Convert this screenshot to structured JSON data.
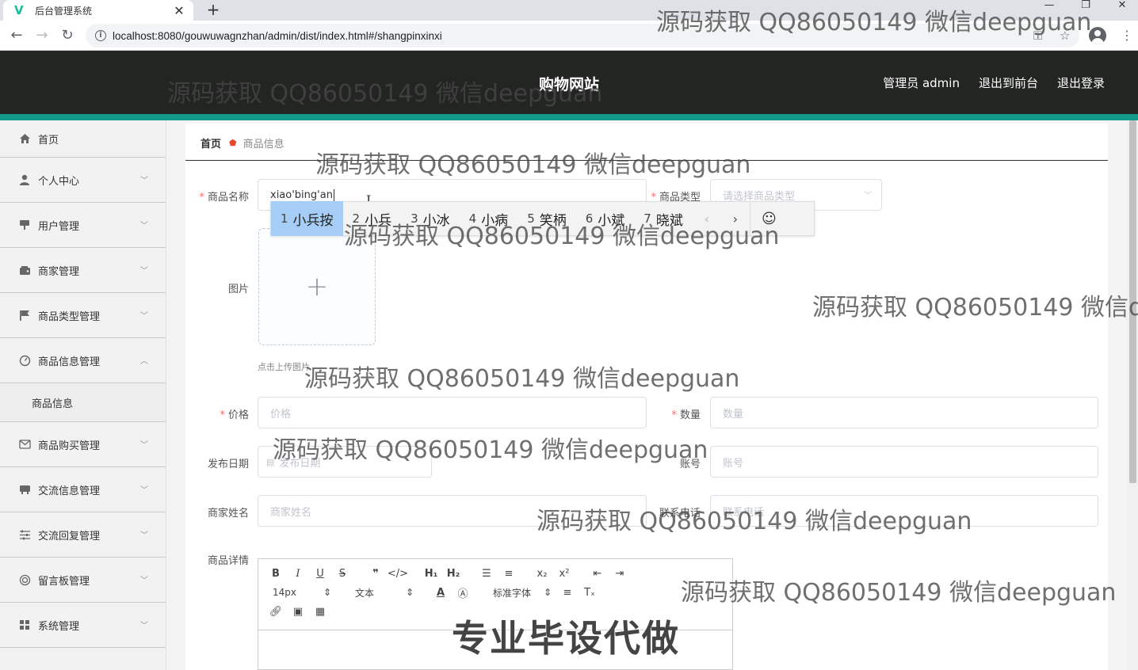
{
  "browser": {
    "tab_title": "后台管理系统",
    "url": "localhost:8080/gouwuwagnzhan/admin/dist/index.html#/shangpinxinxi"
  },
  "header": {
    "site_title": "购物网站",
    "links": [
      "管理员 admin",
      "退出到前台",
      "退出登录"
    ]
  },
  "sidebar": {
    "items": [
      {
        "label": "首页",
        "icon": "home-icon"
      },
      {
        "label": "个人中心",
        "icon": "user-icon"
      },
      {
        "label": "用户管理",
        "icon": "user-manage-icon"
      },
      {
        "label": "商家管理",
        "icon": "wallet-icon"
      },
      {
        "label": "商品类型管理",
        "icon": "flag-icon"
      },
      {
        "label": "商品信息管理",
        "icon": "gauge-icon",
        "expanded": true,
        "children": [
          "商品信息"
        ]
      },
      {
        "label": "商品购买管理",
        "icon": "mail-icon"
      },
      {
        "label": "交流信息管理",
        "icon": "chat-icon"
      },
      {
        "label": "交流回复管理",
        "icon": "sliders-icon"
      },
      {
        "label": "留言板管理",
        "icon": "target-icon"
      },
      {
        "label": "系统管理",
        "icon": "grid-icon"
      }
    ]
  },
  "breadcrumb": {
    "home": "首页",
    "current": "商品信息"
  },
  "form": {
    "name_label": "商品名称",
    "name_value": "xiao'bing'an",
    "type_label": "商品类型",
    "type_placeholder": "请选择商品类型",
    "image_label": "图片",
    "upload_hint": "点击上传图片",
    "price_label": "价格",
    "price_placeholder": "价格",
    "quantity_label": "数量",
    "quantity_placeholder": "数量",
    "date_label": "发布日期",
    "date_placeholder": "发布日期",
    "account_label": "账号",
    "account_placeholder": "账号",
    "merchant_label": "商家姓名",
    "merchant_placeholder": "商家姓名",
    "phone_label": "联系电话",
    "phone_placeholder": "联系电话",
    "detail_label": "商品详情"
  },
  "editor": {
    "font_size": "14px",
    "heading": "文本",
    "font_family": "标准字体"
  },
  "ime": {
    "candidates": [
      {
        "num": "1",
        "text": "小兵按",
        "selected": true
      },
      {
        "num": "2",
        "text": "小兵"
      },
      {
        "num": "3",
        "text": "小冰"
      },
      {
        "num": "4",
        "text": "小病"
      },
      {
        "num": "5",
        "text": "笑柄"
      },
      {
        "num": "6",
        "text": "小斌"
      },
      {
        "num": "7",
        "text": "晓斌"
      }
    ]
  },
  "watermarks": [
    "源码获取 QQ86050149 微信deepguan",
    "源码获取 QQ86050149 微信deepguan",
    "源码获取 QQ86050149 微信deepguan",
    "源码获取 QQ86050149 微信deepguan",
    "源码获取 QQ86050149 微信d",
    "源码获取 QQ86050149 微信deepguan",
    "源码获取 QQ86050149 微信deepguan",
    "源码获取 QQ86050149 微信deepguan",
    "源码获取 QQ86050149 微信deepguan"
  ],
  "promo_text": "专业毕设代做",
  "colors": {
    "header_bg": "#222522",
    "accent": "#149a8b",
    "required": "#f56c6c",
    "ime_selected": "#a6cdf5"
  }
}
